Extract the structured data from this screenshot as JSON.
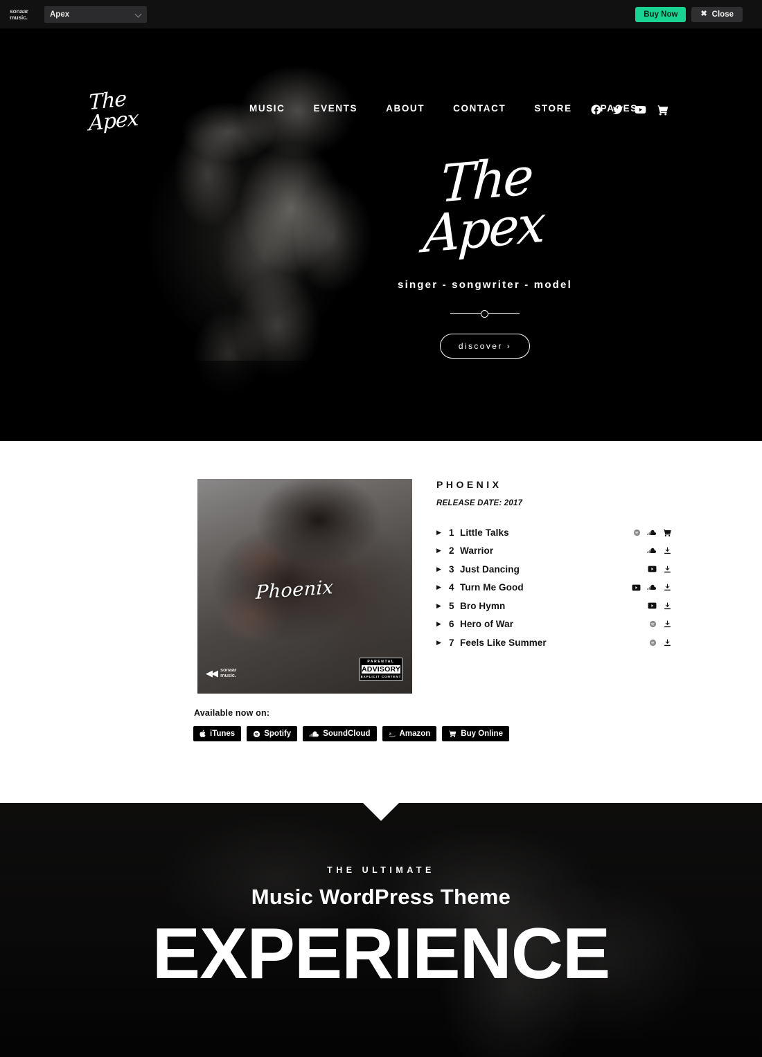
{
  "adminbar": {
    "brand_line1": "sonaar",
    "brand_line2": "music.",
    "theme_selected": "Apex",
    "buy_now_label": "Buy Now",
    "close_label": "Close"
  },
  "site": {
    "logo_text": "The Apex",
    "menu": [
      {
        "label": "MUSIC"
      },
      {
        "label": "EVENTS"
      },
      {
        "label": "ABOUT"
      },
      {
        "label": "CONTACT"
      },
      {
        "label": "STORE"
      },
      {
        "label": "PAGES"
      }
    ],
    "social": [
      {
        "icon": "facebook-icon"
      },
      {
        "icon": "twitter-icon"
      },
      {
        "icon": "youtube-icon"
      },
      {
        "icon": "cart-icon"
      }
    ]
  },
  "hero": {
    "title": "The Apex",
    "subtitle": "singer - songwriter - model",
    "cta_label": "discover",
    "cta_chevron": "›"
  },
  "album": {
    "title": "PHOENIX",
    "release_date": "RELEASE DATE: 2017",
    "cover_signature": "Phoenix",
    "cover_label_line1": "sonaar",
    "cover_label_line2": "music.",
    "advisory_top": "PARENTAL",
    "advisory_mid": "ADVISORY",
    "advisory_bottom": "EXPLICIT CONTENT",
    "tracks": [
      {
        "num": "1",
        "name": "Little Talks",
        "actions": [
          "spotify-icon",
          "soundcloud-icon",
          "cart-icon"
        ]
      },
      {
        "num": "2",
        "name": "Warrior",
        "actions": [
          "soundcloud-icon",
          "download-icon"
        ]
      },
      {
        "num": "3",
        "name": "Just Dancing",
        "actions": [
          "youtube-icon",
          "download-icon"
        ]
      },
      {
        "num": "4",
        "name": "Turn Me Good",
        "actions": [
          "youtube-icon",
          "soundcloud-icon",
          "download-icon"
        ]
      },
      {
        "num": "5",
        "name": "Bro Hymn",
        "actions": [
          "youtube-icon",
          "download-icon"
        ]
      },
      {
        "num": "6",
        "name": "Hero of War",
        "actions": [
          "spotify-icon",
          "download-icon"
        ]
      },
      {
        "num": "7",
        "name": "Feels Like Summer",
        "actions": [
          "spotify-icon",
          "download-icon"
        ]
      }
    ],
    "available_label": "Available now on:",
    "store_buttons": [
      {
        "label": "iTunes",
        "icon": "apple-icon"
      },
      {
        "label": "Spotify",
        "icon": "spotify-icon"
      },
      {
        "label": "SoundCloud",
        "icon": "soundcloud-icon"
      },
      {
        "label": "Amazon",
        "icon": "amazon-icon"
      },
      {
        "label": "Buy Online",
        "icon": "cart-icon"
      }
    ]
  },
  "experience": {
    "eyebrow": "THE ULTIMATE",
    "subtitle": "Music WordPress Theme",
    "headline": "EXPERIENCE"
  },
  "colors": {
    "accent_green": "#19d392",
    "admin_bg": "#111112",
    "dark": "#000000",
    "light": "#ffffff"
  }
}
